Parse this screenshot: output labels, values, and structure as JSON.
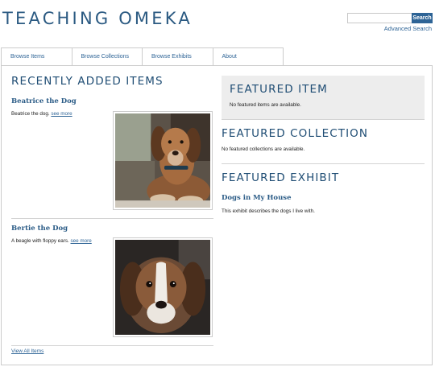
{
  "site": {
    "title": "TEACHING OMEKA"
  },
  "search": {
    "placeholder": "",
    "button_label": "Search",
    "advanced_label": "Advanced Search"
  },
  "nav": {
    "items": [
      {
        "label": "Browse Items"
      },
      {
        "label": "Browse Collections"
      },
      {
        "label": "Browse Exhibits"
      },
      {
        "label": "About"
      }
    ]
  },
  "recent": {
    "title": "RECENTLY ADDED ITEMS",
    "items": [
      {
        "title": "Beatrice the Dog",
        "description": "Beatrice the dog.",
        "more_label": "see more",
        "icon": "dog-photo"
      },
      {
        "title": "Bertie the Dog",
        "description": "A beagle with floppy ears.",
        "more_label": "see more",
        "icon": "dog-photo"
      }
    ],
    "view_all_label": "View All Items"
  },
  "featured_item": {
    "title": "FEATURED ITEM",
    "message": "No featured items are available."
  },
  "featured_collection": {
    "title": "FEATURED COLLECTION",
    "message": "No featured collections are available."
  },
  "featured_exhibit": {
    "title": "FEATURED EXHIBIT",
    "exhibit_title": "Dogs in My House",
    "description": "This exhibit describes the dogs I live with."
  },
  "colors": {
    "brand": "#2b5a82",
    "link": "#2e6496",
    "button": "#2e6496",
    "featured_bg": "#ededed"
  }
}
